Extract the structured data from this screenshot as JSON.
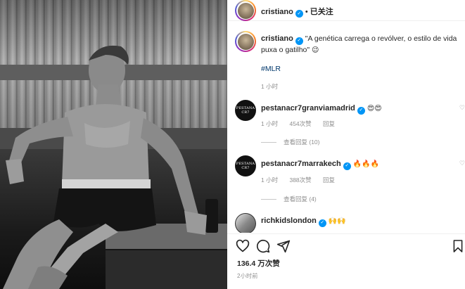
{
  "post": {
    "author": "cristiano",
    "follow_label": "已关注",
    "separator": "•",
    "caption": "\"A genética carrega o revólver, o estilo de vida puxa o gatilho\"",
    "caption_emoji": "😉",
    "hashtag": "#MLR",
    "caption_time": "1 小时",
    "likes": "136.4 万次赞",
    "posted_ago": "2小时前"
  },
  "comments": [
    {
      "username": "pestanacr7granviamadrid",
      "text": "😍😍",
      "time": "1 小时",
      "likes": "454次赞",
      "reply": "回复",
      "view_replies": "查看回复 (10)",
      "avatar_text": "PESTANA CR7"
    },
    {
      "username": "pestanacr7marrakech",
      "text": "🔥🔥🔥",
      "time": "1 小时",
      "likes": "388次赞",
      "reply": "回复",
      "view_replies": "查看回复 (4)",
      "avatar_text": "PESTANA CR7"
    },
    {
      "username": "richkidslondon",
      "text": "🙌🙌"
    }
  ],
  "icons": {
    "like": "heart-icon",
    "comment": "comment-icon",
    "share": "share-icon",
    "save": "bookmark-icon"
  },
  "colors": {
    "verified": "#0095f6",
    "hashtag": "#00376b",
    "muted": "#8e8e8e"
  }
}
